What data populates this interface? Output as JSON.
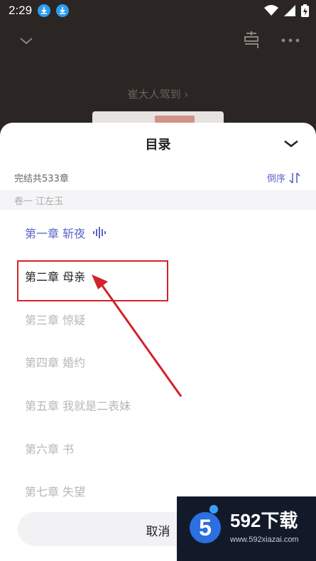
{
  "status_bar": {
    "time": "2:29"
  },
  "background": {
    "author_link": "崔大人驾到 ›"
  },
  "sheet": {
    "title": "目录",
    "meta": "完结共533章",
    "order_label": "倒序",
    "volume": "卷一 江左玉",
    "chapters": [
      {
        "label": "第一章 斩夜",
        "state": "current"
      },
      {
        "label": "第二章 母亲",
        "state": "highlighted"
      },
      {
        "label": "第三章 惊疑",
        "state": "normal"
      },
      {
        "label": "第四章 婚约",
        "state": "normal"
      },
      {
        "label": "第五章 我就是二表妹",
        "state": "normal"
      },
      {
        "label": "第六章 书",
        "state": "normal"
      },
      {
        "label": "第七章 失望",
        "state": "normal"
      }
    ],
    "cancel_label": "取消"
  },
  "watermark": {
    "brand": "592下载",
    "logo_text": "5",
    "url": "www.592xiazai.com"
  },
  "colors": {
    "accent": "#5a63c8",
    "annotation": "#d2232a"
  }
}
